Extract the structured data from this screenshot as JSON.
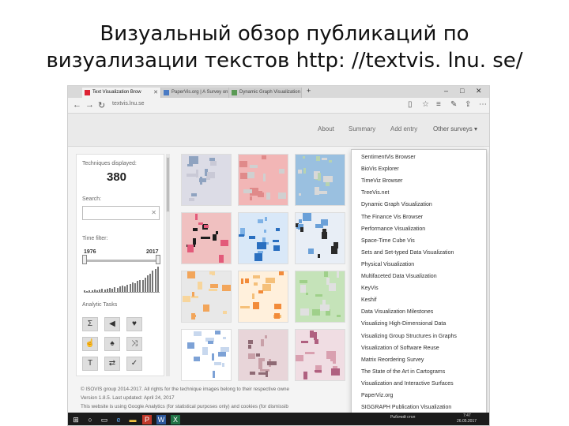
{
  "slide": {
    "title_line1": "Визуальный обзор публикаций по",
    "title_line2": "визуализации текстов http: //textvis. lnu. se/"
  },
  "browser": {
    "tabs": [
      {
        "label": "Text Visualization Brow"
      },
      {
        "label": "PaperVis.org | A Survey on"
      },
      {
        "label": "Dynamic Graph Visualization"
      }
    ],
    "url": "textvis.lnu.se"
  },
  "site_nav": {
    "about": "About",
    "summary": "Summary",
    "add_entry": "Add entry",
    "other_surveys": "Other surveys"
  },
  "left_panel": {
    "techniques_label": "Techniques displayed:",
    "techniques_count": "380",
    "search_label": "Search:",
    "search_placeholder": "",
    "time_filter_label": "Time filter:",
    "year_start": "1976",
    "year_end": "2017",
    "analytic_tasks_label": "Analytic Tasks"
  },
  "dropdown": {
    "items": [
      "SentimentVis Browser",
      "BioVis Explorer",
      "TimeViz Browser",
      "TreeVis.net",
      "Dynamic Graph Visualization",
      "The Finance Vis Browser",
      "Performance Visualization",
      "Space-Time Cube Vis",
      "Sets and Set-typed Data Visualization",
      "Physical Visualization",
      "Multifaceted Data Visualization",
      "KeyVis",
      "Keshif",
      "Data Visualization Milestones",
      "Visualizing High-Dimensional Data",
      "Visualizing Group Structures in Graphs",
      "Visualization of Software Reuse",
      "Matrix Reordering Survey",
      "The State of the Art in Cartograms",
      "Visualization and Interactive Surfaces",
      "PaperViz.org",
      "SIGGRAPH Publication Visualization"
    ]
  },
  "footer": {
    "line1": "© ISOVIS group 2014-2017. All rights for the technique images belong to their respective owne",
    "line2": "Version 1.8.5. Last updated: April 24, 2017",
    "line3": "This website is using Google Analytics (for statistical purposes only) and cookies (for dismissib"
  },
  "taskbar": {
    "tray_text": "Рабочий стол",
    "clock_time": "7:47",
    "clock_date": "26.05.2017"
  },
  "histogram": [
    2,
    1,
    2,
    2,
    3,
    2,
    3,
    4,
    3,
    4,
    5,
    4,
    6,
    5,
    7,
    8,
    7,
    9,
    10,
    12,
    11,
    14,
    16,
    15,
    19,
    22,
    24,
    28,
    30,
    33
  ]
}
